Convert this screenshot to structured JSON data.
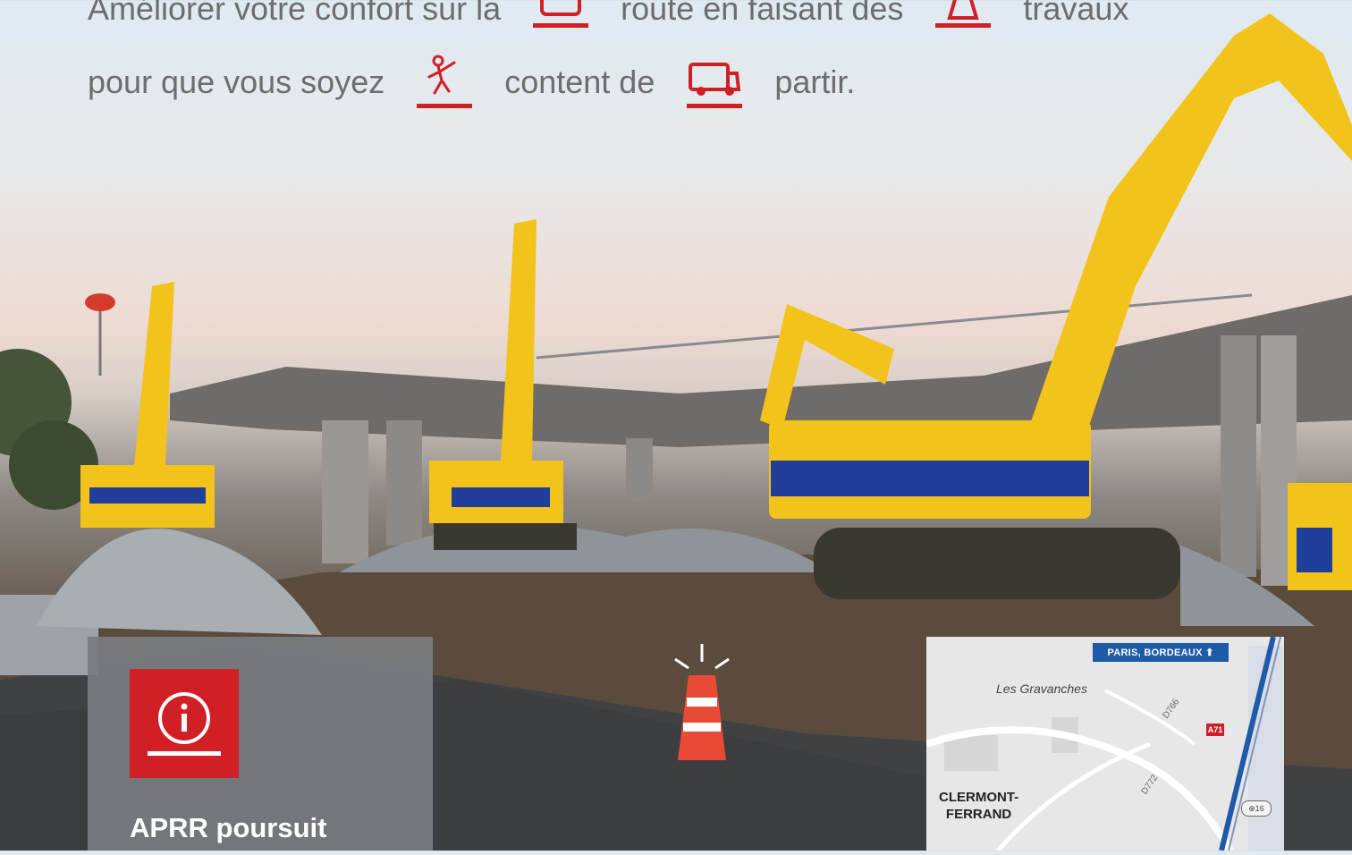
{
  "slogan": {
    "line1": [
      "Améliorer votre confort sur la",
      "route en faisant des",
      "travaux"
    ],
    "line2": [
      "pour que vous soyez",
      "content de",
      "partir."
    ],
    "icons": [
      "car-icon",
      "traffic-cone-icon",
      "happy-person-icon",
      "camper-van-icon"
    ]
  },
  "info_card": {
    "icon": "info-icon",
    "title": "APRR poursuit"
  },
  "map": {
    "direction_sign": "PARIS, BORDEAUX ⬆",
    "place_label": "Les Gravanches",
    "city_label": "CLERMONT-\nFERRAND",
    "road_label_1": "D766",
    "road_label_2": "D772",
    "motorway_label": "A71",
    "exit_label": "⊕16"
  },
  "colors": {
    "accent_red": "#d11f26",
    "machine_yellow": "#f2c31a",
    "machine_blue": "#1f3f9a",
    "map_blue": "#1d5aa8"
  }
}
